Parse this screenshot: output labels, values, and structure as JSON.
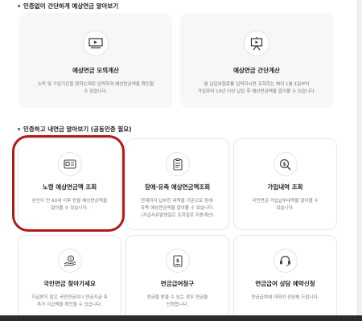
{
  "section1": {
    "title": "인증없이 간단하게 예상연금 알아보기",
    "cards": [
      {
        "icon": "video-play-icon",
        "title": "예상연금 모의계산",
        "desc": "소득 및 가입기간을 원하는대로 입력하여 예상연금액을 확인할\n수 있습니다."
      },
      {
        "icon": "presentation-play-icon",
        "title": "예상연금 간단계산",
        "desc": "월 납입보험료를 입력하시면 조회하는 해의 1월 1일부터\n가입하여 10년 이상 납입 후 예상연금액을 알아볼 수 있습니다."
      }
    ]
  },
  "section2": {
    "title": "인증하고 내연금 알아보기 (공동인증 필요)",
    "cards": [
      {
        "icon": "id-card-icon",
        "title": "노령 예상연금액 조회",
        "desc": "본인이 만 60세 이후 받을 예상연금액을\n알아볼 수 있습니다."
      },
      {
        "icon": "document-list-icon",
        "title": "장애·유족 예상연금액조회",
        "desc": "현재까지 납부한 내역을 기준으로 장애·\n유족 예상연금액을 알아볼 수 있습니다.\n(지급사유발생일은 조회일로 자동계산)"
      },
      {
        "icon": "dollar-search-icon",
        "title": "가입내역 조회",
        "desc": "국민연금 가입납부내역을 알아볼 수\n있습니다."
      },
      {
        "icon": "hand-coin-icon",
        "title": "국민연금 찾아가세요",
        "desc": "지급받지 않은 국민연금이나 연금지급 후\n추가 지급액을 확인할 수 있습니다."
      },
      {
        "icon": "money-document-icon",
        "title": "연금급여청구",
        "desc": "연금을 받을 수 있는 경우 연금을\n신청합니다."
      },
      {
        "icon": "headset-icon",
        "title": "연금급여 상담 예약신청",
        "desc": "연금급여에 대하여 상담해 드립니다."
      }
    ]
  }
}
